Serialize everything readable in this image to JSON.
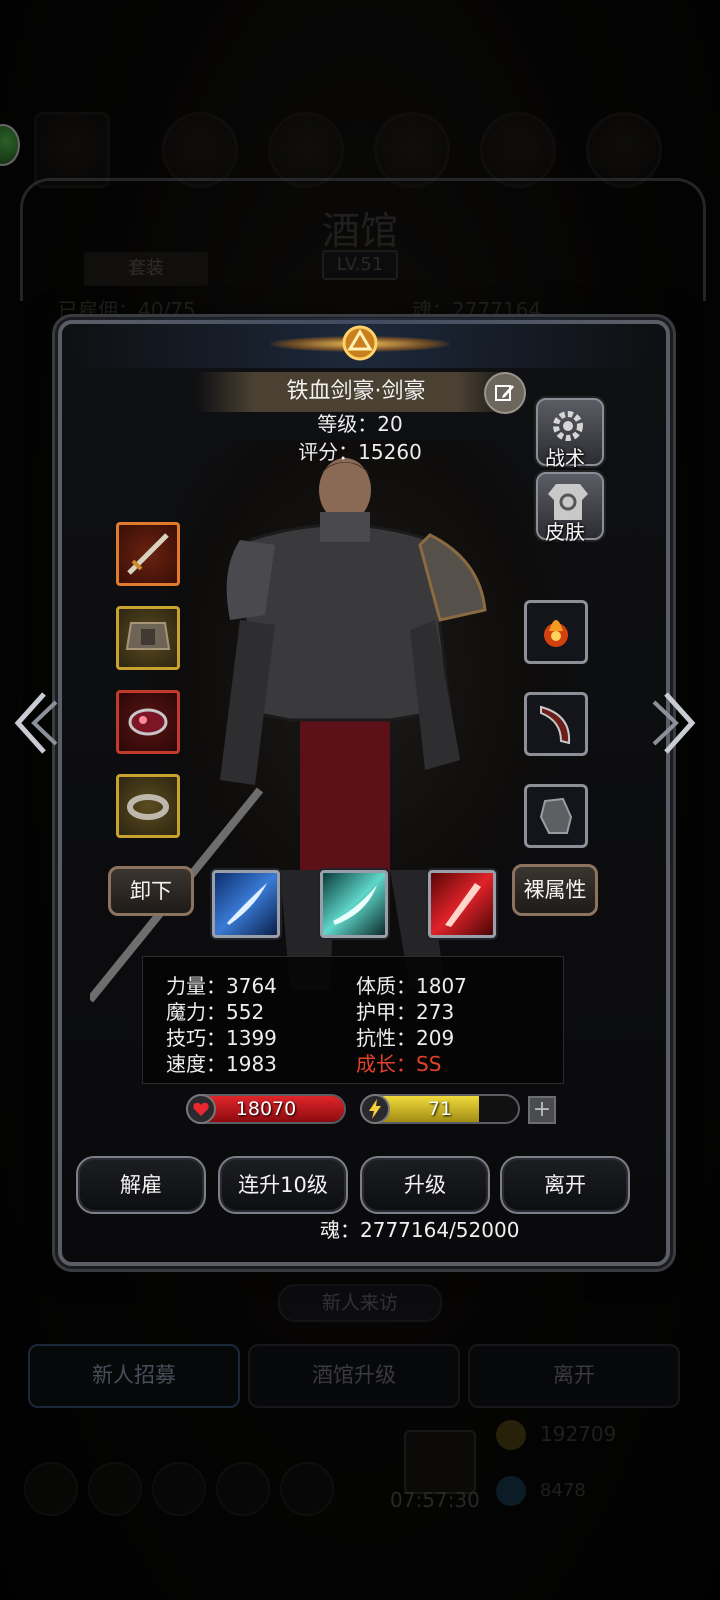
{
  "background": {
    "title": "酒馆",
    "level": "LV.51",
    "tab": "套装",
    "count_text": "已雇佣：40/75",
    "soul_text": "魂：2777164",
    "new_visit": "新人来访",
    "bottom_buttons": [
      "新人招募",
      "酒馆升级",
      "离开"
    ],
    "timer": "07:57:30",
    "gold": "192709",
    "gems": "8478"
  },
  "hero": {
    "name": "铁血剑豪·剑豪",
    "level_text": "等级：20",
    "score_text": "评分：15260"
  },
  "side_buttons": {
    "tactics": "战术",
    "skin": "皮肤"
  },
  "equipment_left": [
    {
      "name": "sword",
      "rarity": "orange"
    },
    {
      "name": "armor",
      "rarity": "gold"
    },
    {
      "name": "gem",
      "rarity": "red"
    },
    {
      "name": "ring",
      "rarity": "gold"
    }
  ],
  "equipment_right": [
    "fire-orb-icon",
    "horn-icon",
    "gauntlet-icon"
  ],
  "actions_row": {
    "unequip": "卸下",
    "base_attr": "裸属性"
  },
  "skills": [
    "ice-slash-icon",
    "wind-slash-icon",
    "blood-slash-icon"
  ],
  "attributes": {
    "left": [
      "力量：3764",
      "魔力：552",
      "技巧：1399",
      "速度：1983"
    ],
    "right": [
      "体质：1807",
      "护甲：273",
      "抗性：209"
    ],
    "growth": "成长：SS"
  },
  "hp": "18070",
  "energy": "71",
  "energy_fill": 0.75,
  "buttons": [
    "解雇",
    "连升10级",
    "升级",
    "离开"
  ],
  "soul": "魂：2777164/52000",
  "colors": {
    "hp_bar": "#c4151a",
    "energy_bar": "#d4c02a",
    "growth_red": "#e3412a"
  }
}
